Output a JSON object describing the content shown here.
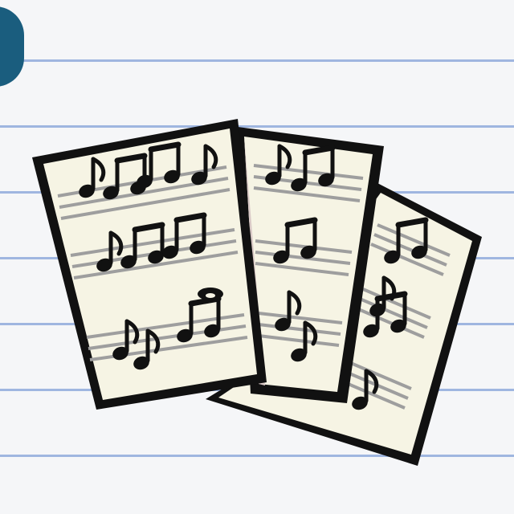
{
  "icon": "sheet-music-icon",
  "colors": {
    "background": "#f5f6f8",
    "rule_line": "#9fb6e0",
    "tab": "#1a5d7e",
    "sheet": "#f6f4e4",
    "sheet_shadow": "#d9c9c6",
    "staff": "#9e9e9e",
    "ink": "#111111"
  }
}
